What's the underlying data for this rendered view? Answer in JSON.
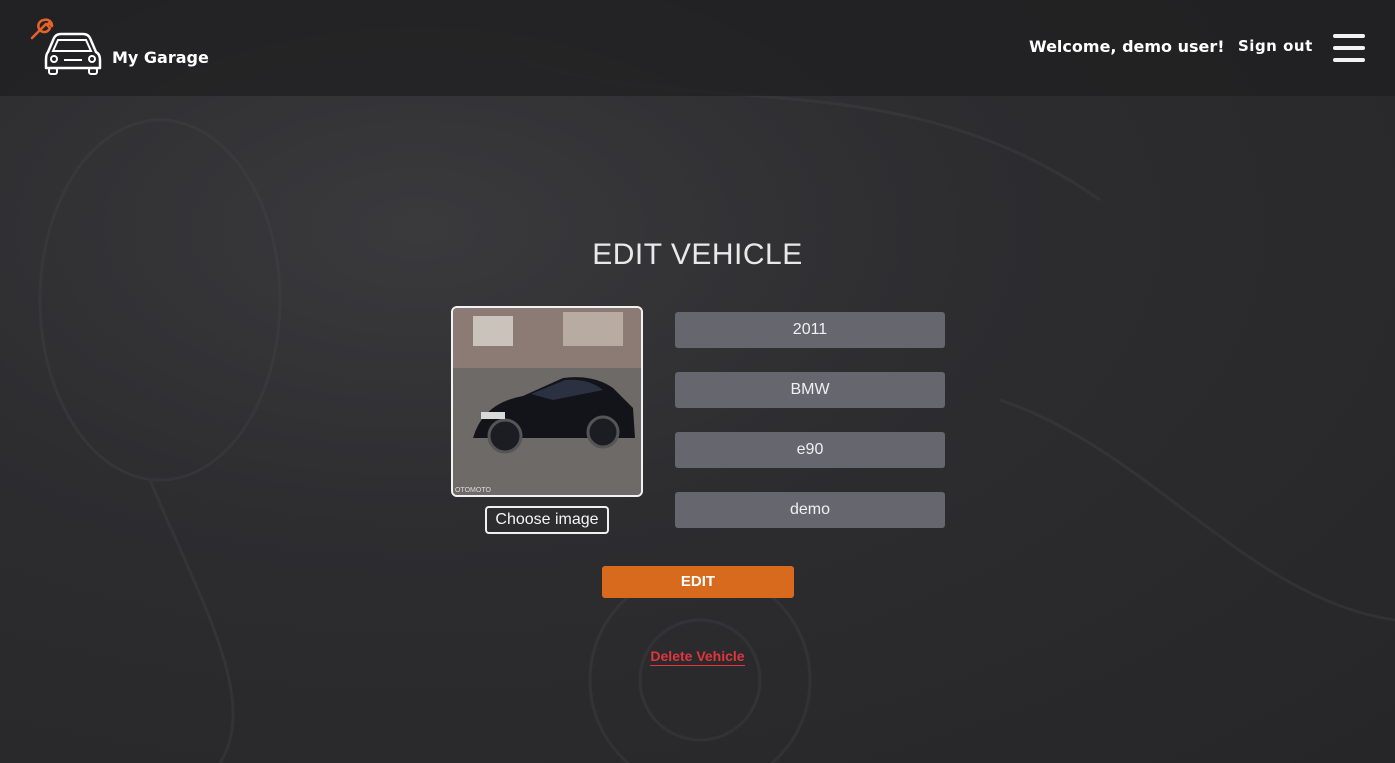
{
  "header": {
    "brand": "My Garage",
    "welcome": "Welcome, demo user!",
    "sign_out": "Sign out"
  },
  "page": {
    "title": "EDIT VEHICLE"
  },
  "vehicle": {
    "choose_image_label": "Choose image",
    "year": "2011",
    "make": "BMW",
    "model": "e90",
    "owner": "demo",
    "photo_watermark": "OTOMOTO"
  },
  "actions": {
    "edit_label": "EDIT",
    "delete_label": "Delete Vehicle"
  },
  "colors": {
    "accent": "#d86a1e",
    "danger": "#e0363c",
    "field_bg": "#66666e",
    "logo_wrench": "#e8632b"
  },
  "icons": {
    "logo": "car-with-wrench-icon",
    "menu": "hamburger-menu-icon"
  }
}
